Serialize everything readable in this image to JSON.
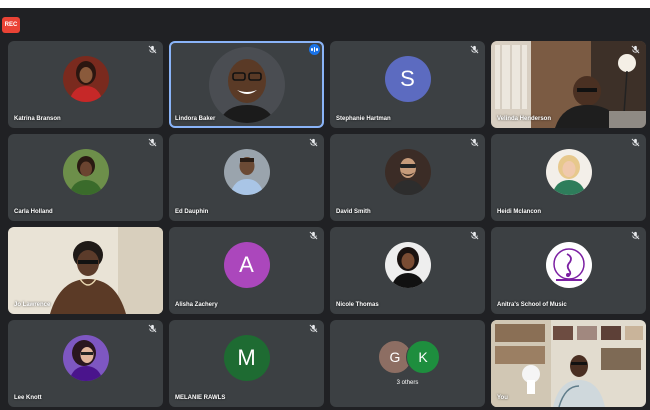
{
  "recording_label": "REC",
  "colors": {
    "background": "#202124",
    "tile": "#3c4043",
    "speaking_border": "#8ab4f8",
    "speaking_badge": "#1a73e8",
    "avatar_s": "#5c6bc0",
    "avatar_a": "#ab47bc",
    "avatar_m": "#1e6b32",
    "avatar_g": "#8d6e63",
    "avatar_k": "#1e8e3e"
  },
  "participants": [
    {
      "name": "Katrina Branson",
      "tile": "photo-avatar",
      "muted": true
    },
    {
      "name": "Lindora Baker",
      "tile": "photo-avatar",
      "speaking": true
    },
    {
      "name": "Stephanie Hartman",
      "tile": "letter-avatar",
      "letter": "S",
      "muted": true
    },
    {
      "name": "Velinda Henderson",
      "tile": "video",
      "muted": true
    },
    {
      "name": "Carla Holland",
      "tile": "photo-avatar",
      "muted": true
    },
    {
      "name": "Ed Dauphin",
      "tile": "photo-avatar",
      "muted": true
    },
    {
      "name": "David Smith",
      "tile": "photo-avatar",
      "muted": true
    },
    {
      "name": "Heidi Mclancon",
      "tile": "photo-avatar",
      "muted": true
    },
    {
      "name": "Jo Lawrence",
      "tile": "video",
      "muted": false
    },
    {
      "name": "Alisha Zachery",
      "tile": "letter-avatar",
      "letter": "A",
      "muted": true
    },
    {
      "name": "Nicole Thomas",
      "tile": "photo-avatar",
      "muted": true
    },
    {
      "name": "Anitra's School of Music",
      "tile": "logo-avatar",
      "muted": true
    },
    {
      "name": "Lee Knott",
      "tile": "photo-avatar",
      "muted": true
    },
    {
      "name": "MELANIE RAWLS",
      "tile": "letter-avatar",
      "letter": "M",
      "muted": true
    }
  ],
  "others": {
    "letters": [
      "G",
      "K"
    ],
    "label": "3 others"
  },
  "self_tile": {
    "name": "You",
    "tile": "video"
  }
}
